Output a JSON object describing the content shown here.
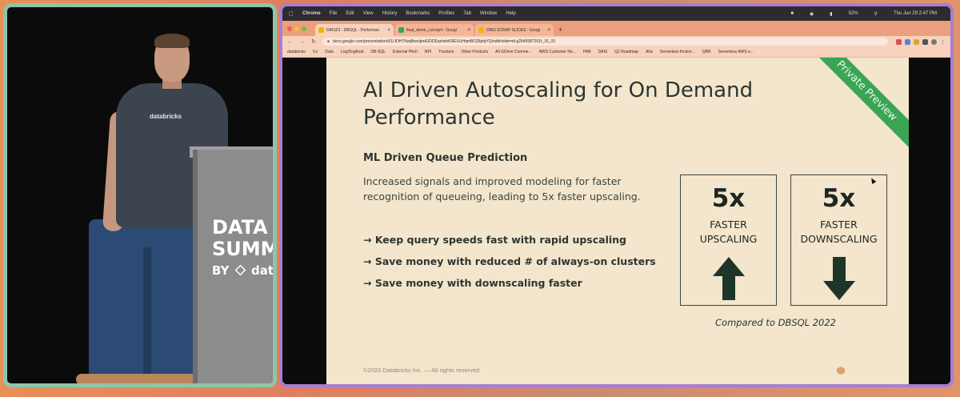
{
  "podium": {
    "line1": "DATA",
    "line2": "SUMM",
    "by": "BY",
    "brand": "datab"
  },
  "speaker_shirt_logo": "databricks",
  "menubar": {
    "app": "Chrome",
    "items": [
      "File",
      "Edit",
      "View",
      "History",
      "Bookmarks",
      "Profiles",
      "Tab",
      "Window",
      "Help"
    ],
    "battery": "92%",
    "clock": "Thu Jun 29  2:47 PM"
  },
  "browser": {
    "tabs": [
      {
        "title": "DAIS23 - DBSQL - Performan",
        "active": true,
        "icon_color": "#f4b400"
      },
      {
        "title": "final_demo_cut.mp4 - Googl",
        "active": false,
        "icon_color": "#34a853"
      },
      {
        "title": "DAIS SCRAP SLIDES - Googl",
        "active": false,
        "icon_color": "#f4b400"
      }
    ],
    "url": "docs.google.com/presentation/d/1LfDH7NxqBwslpmEIDDEqnIwhKREXUHqmBO28plqYQ/edit#slide=id.g2546987291f_16_33",
    "bookmarks": [
      "databricks",
      "Co",
      "Data",
      "Log/Dogfood",
      "DB-SQL",
      "External Pitch",
      "NPI",
      "Trackers",
      "Other Products",
      "All GDrive Comme...",
      "AWS Customer No...",
      "PAB",
      "DAIS",
      "Q2 Roadmap",
      "Aha",
      "Serverless friction...",
      "QBR",
      "Serverless AWS e..."
    ]
  },
  "slide": {
    "title": "AI Driven Autoscaling for On Demand Performance",
    "ribbon": "Private Preview",
    "section_heading": "ML Driven Queue Prediction",
    "description": "Increased signals and improved modeling for faster recognition of queueing, leading to 5x faster upscaling.",
    "bullets": [
      "→ Keep query speeds fast with rapid upscaling",
      "→ Save money with reduced # of always-on clusters",
      "→ Save money with downscaling faster"
    ],
    "stats": [
      {
        "value": "5x",
        "label_line1": "FASTER",
        "label_line2": "UPSCALING",
        "direction": "up"
      },
      {
        "value": "5x",
        "label_line1": "FASTER",
        "label_line2": "DOWNSCALING",
        "direction": "down"
      }
    ],
    "caption": "Compared to DBSQL 2022",
    "footer": "©2023 Databricks Inc. — All rights reserved",
    "colors": {
      "slide_bg": "#f3e6cd",
      "text": "#2d3530",
      "ribbon": "#3aa555",
      "arrow": "#1e3529"
    }
  }
}
